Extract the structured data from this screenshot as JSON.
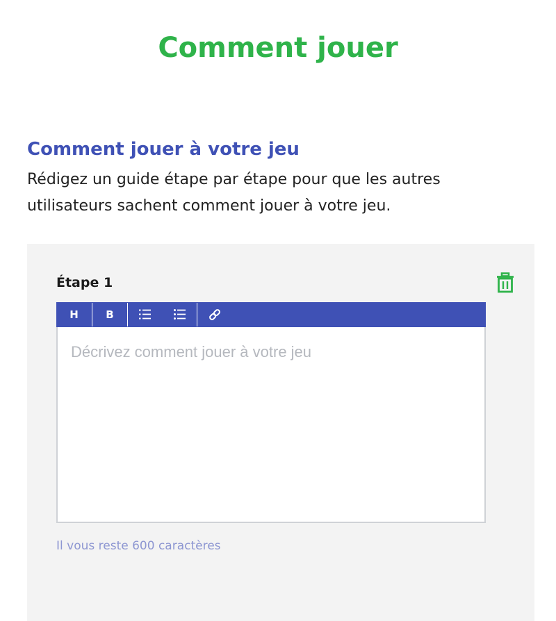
{
  "page": {
    "title": "Comment jouer"
  },
  "section": {
    "heading": "Comment jouer à votre jeu",
    "description": "Rédigez un guide étape par étape pour que les autres utilisateurs sachent comment jouer à votre jeu."
  },
  "step": {
    "label": "Étape 1",
    "delete_icon": "trash-icon",
    "toolbar": {
      "heading_label": "H",
      "bold_label": "B",
      "ordered_list_icon": "ordered-list-icon",
      "bullet_list_icon": "bullet-list-icon",
      "link_icon": "link-icon"
    },
    "editor": {
      "value": "",
      "placeholder": "Décrivez comment jouer à votre jeu"
    },
    "char_count": "Il vous reste 600 caractères"
  },
  "colors": {
    "title_green": "#2fb34a",
    "accent_blue": "#3f51b5",
    "panel_bg": "#f3f3f3",
    "muted_blue": "#8e97d2"
  }
}
